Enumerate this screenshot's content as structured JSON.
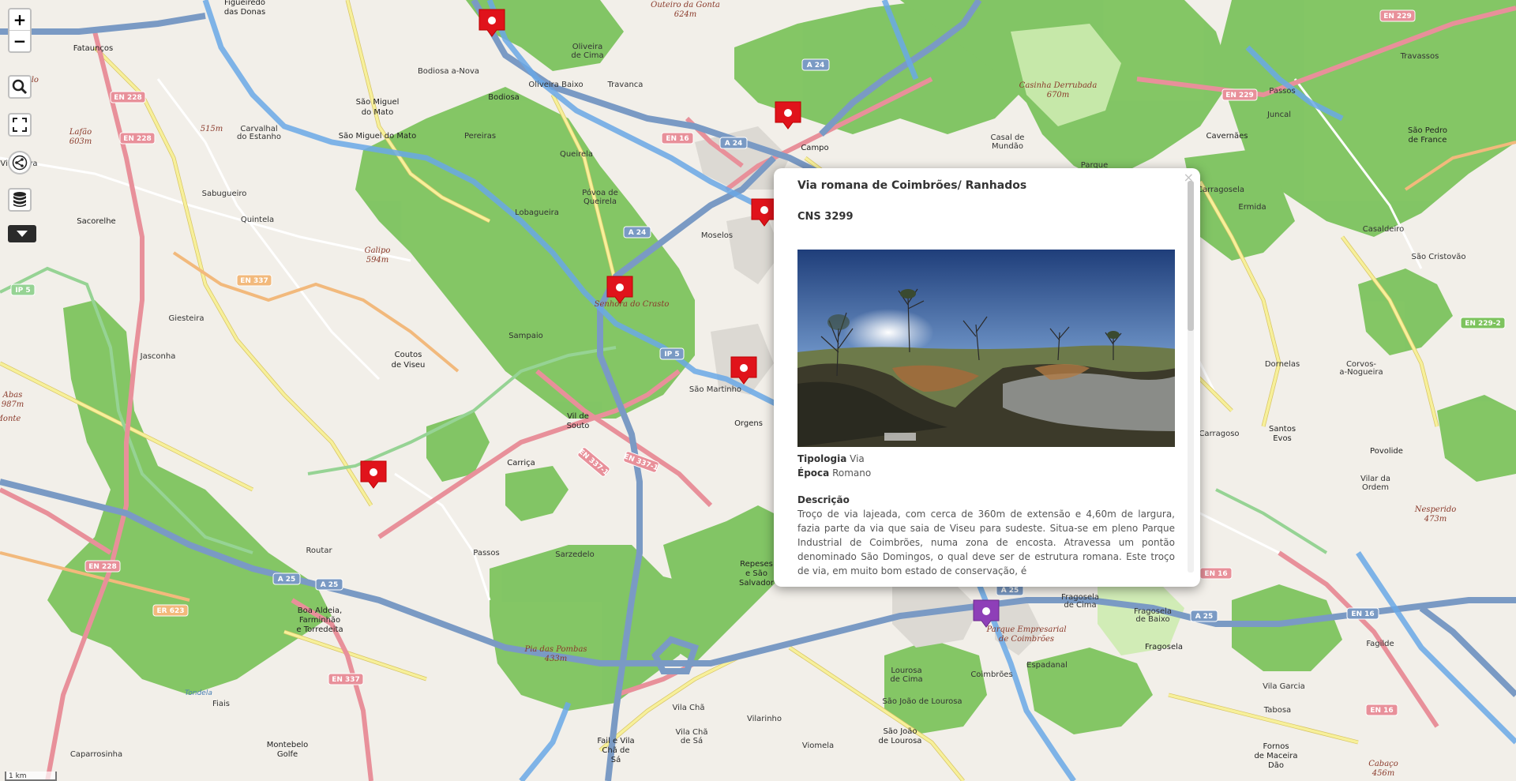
{
  "controls": {
    "zoom_in": "+",
    "zoom_out": "−",
    "search_icon": "search-icon",
    "fullscreen_icon": "fullscreen-icon",
    "share_icon": "share-icon",
    "layers_icon": "layers-icon",
    "dropdown_icon": "caret-down-icon"
  },
  "scale": {
    "label": "1 km"
  },
  "popup": {
    "close": "×",
    "title": "Via romana de Coimbrões/ Ranhados",
    "cns": "CNS 3299",
    "tipologia_label": "Tipologia",
    "tipologia_value": "Via",
    "epoca_label": "Época",
    "epoca_value": "Romano",
    "descricao_label": "Descrição",
    "descricao_text": "Troço de via lajeada, com cerca de 360m de extensão e 4,60m de largura, fazia parte da via que saia de Viseu para sudeste. Situa-se em pleno Parque Industrial de Coimbrões, numa zona de encosta. Atravessa um pontão denominado São Domingos, o qual deve ser de estrutura romana. Este troço de via, em muito bom estado de conservação, é"
  },
  "colors": {
    "forest": "#7dc35e",
    "motorway": "#7a9ac4",
    "trunk": "#e8909a",
    "primary": "#f7d77a",
    "river": "#8fbbe8",
    "marker_red": "#e0131b",
    "marker_purple": "#8e3fb8"
  },
  "labels": {
    "figueiredo": "Figueiredo",
    "das_donas": "das Donas",
    "outeiro_gonta": "Outeiro da Gonta",
    "alt624": "624m",
    "fataucos": "Fataunços",
    "castelo": "Castelo",
    "bodiosa_a_nova": "Bodiosa a-Nova",
    "bodiosa": "Bodiosa",
    "oliveira": "Oliveira",
    "de_cima": "de Cima",
    "oliveira_baixo": "Oliveira Baixo",
    "travanca": "Travanca",
    "sao_miguel": "São Miguel",
    "do_mato": "do Mato",
    "sao_miguel_do_mato": "São Miguel do Mato",
    "lafao": "Lafão",
    "alt603": "603m",
    "alt515": "515m",
    "carvalhal": "Carvalhal",
    "do_estanho": "do Estanho",
    "vila_nova": "Vila Nova",
    "pereiras": "Pereiras",
    "queirela": "Queirela",
    "sacorelhe": "Sacorelhe",
    "sabugueiro": "Sabugueiro",
    "quintela": "Quintela",
    "povoa": "Póvoa de",
    "queirela2": "Queirela",
    "lobagueira": "Lobagueira",
    "galipo": "Galipo",
    "alt594": "594m",
    "moselos": "Moselos",
    "campo": "Campo",
    "casinha_derrubada": "Casinha Derrubada",
    "alt670": "670m",
    "casal": "Casal de",
    "mundao": "Mundão",
    "parque": "Parque",
    "caveranhes": "Cavernães",
    "passos": "Passos",
    "juncal": "Juncal",
    "sao_pedro": "São Pedro",
    "de_france": "de France",
    "travassos": "Travassos",
    "carragosela": "Carragosela",
    "ermida": "Ermida",
    "casaldeiro": "Casaldeiro",
    "sao_cristovao": "São Cristovão",
    "giesteira": "Giesteira",
    "coutos": "Coutos",
    "de_viseu": "de Viseu",
    "jasconha": "Jasconha",
    "sampaio": "Sampaio",
    "senhora_castro": "Senhora do Crasto",
    "sao_martinho": "São Martinho",
    "orgens": "Orgens",
    "vil_de_souto": "Vil de",
    "souto": "Souto",
    "carrica": "Carriça",
    "abas": "Abas",
    "alt987": "987m",
    "monte": "Monte",
    "dornelas": "Dornelas",
    "corvos": "Corvos-",
    "a_nogueira": "a-Nogueira",
    "santos": "Santos",
    "evos": "Evos",
    "povolide": "Povolide",
    "carragoso": "Carragoso",
    "vilar": "Vilar da",
    "ordem": "Ordem",
    "nesperido": "Nesperido",
    "alt473": "473m",
    "routar": "Routar",
    "passos2": "Passos",
    "sarzedelo": "Sarzedelo",
    "repeses": "Repeses",
    "e_sao": "e São",
    "salvador": "Salvador",
    "boa_aldeia": "Boa Aldeia,",
    "farminhao": "Farminhão",
    "torredeita": "e Torredeita",
    "pia_pombas": "Pia das Pombas",
    "alt433": "433m",
    "parque_empresarial": "Parque Empresarial",
    "de_coimbroes": "de Coimbrões",
    "fragosela_cima": "Fragosela",
    "de_cima2": "de Cima",
    "fragosela_baixo": "Fragosela",
    "de_baixo": "de Baixo",
    "fragosela": "Fragosela",
    "espadanal": "Espadanal",
    "lourosa": "Lourosa",
    "de_cima3": "de Cima",
    "coimbroes": "Coimbrões",
    "sao_joao_lourosa": "São João de Lourosa",
    "sao_joao": "São João",
    "de_lourosa": "de Lourosa",
    "vila_garcia": "Vila Garcia",
    "tabosa": "Tabosa",
    "fagilde": "Fagilde",
    "montebelo": "Montebelo",
    "golfe": "Golfe",
    "vila_cha": "Vila Chã",
    "vila_cha2": "Vila Chã",
    "de_sa": "de Sá",
    "fail": "Fail e Vila",
    "cha_de": "Chã de",
    "sa": "Sá",
    "vilarinho": "Vilarinho",
    "caparrosinha": "Caparrosinha",
    "viomela": "Viomela",
    "fornos": "Fornos",
    "de_maceira": "de Maceira",
    "dao": "Dão",
    "cabaco": "Cabaço",
    "alt456": "456m",
    "tondela": "Tondela",
    "fiais": "Fiais"
  },
  "road_refs": {
    "en228_a": "EN 228",
    "en228_b": "EN 228",
    "en228_c": "EN 228",
    "en229": "EN 229",
    "en229_top": "EN 229",
    "en229_2": "EN 229-2",
    "en337": "EN 337",
    "en337_b": "EN 337",
    "en337_1": "EN 337-1",
    "en337_1b": "EN 337-1",
    "er623": "ER 623",
    "en16_a": "EN 16",
    "en16_b": "EN 16",
    "en16_c": "EN 16",
    "en16_d": "EN 16",
    "a24_a": "A 24",
    "a24_b": "A 24",
    "a24_c": "A 24",
    "a25_a": "A 25",
    "a25_b": "A 25",
    "a25_c": "A 25",
    "a25_d": "A 25",
    "ip5_a": "IP 5",
    "ip5_b": "IP 5"
  }
}
